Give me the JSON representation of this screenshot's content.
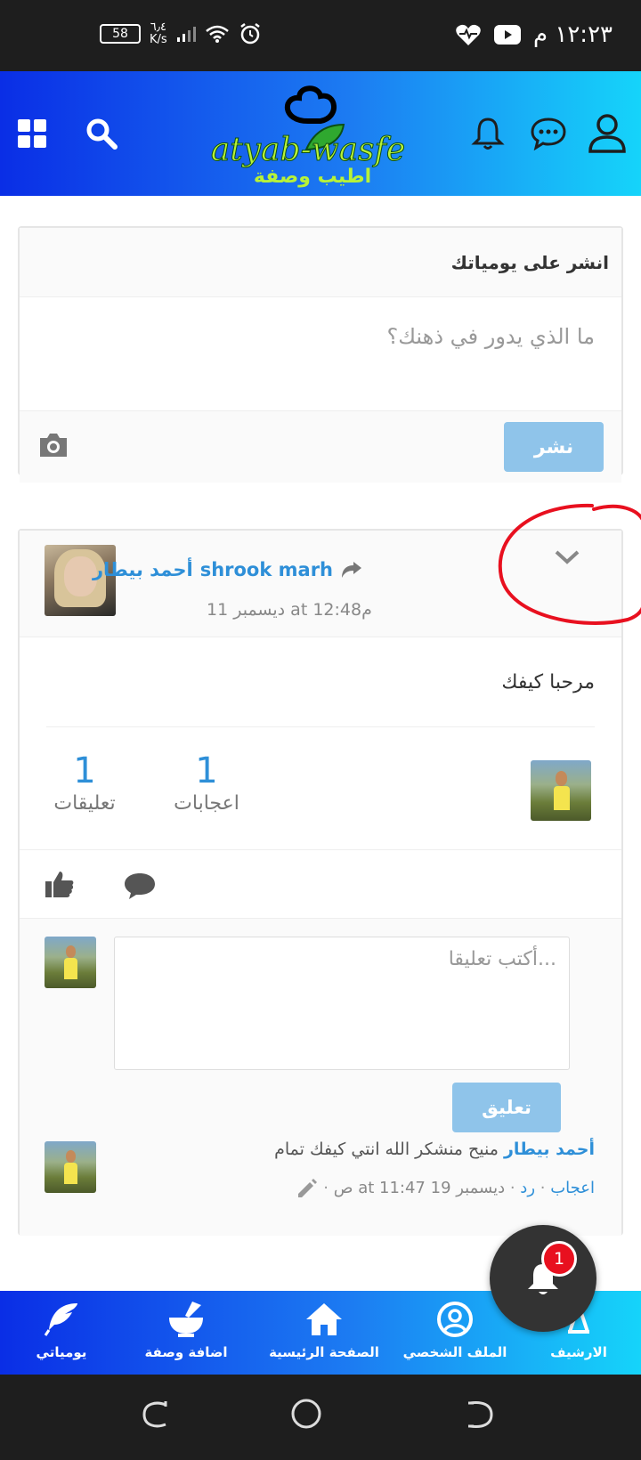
{
  "status_bar": {
    "battery": "58",
    "net_speed_value": "٦٫٤",
    "net_speed_unit": "K/s",
    "time": "١٢:٢٣ م"
  },
  "header": {
    "logo_text": "atyab-wasfe",
    "logo_subtitle": "اطيب وصفة"
  },
  "composer": {
    "title": "انشر على يومياتك",
    "placeholder": "ما الذي يدور في ذهنك؟",
    "publish_label": "نشر"
  },
  "post": {
    "author": "shrook marh",
    "shared_with": "أحمد بيطار",
    "timestamp": "ديسمبر 11 at 12:48م",
    "text": "مرحبا كيفك",
    "likes_count": "1",
    "likes_label": "اعجابات",
    "comments_count": "1",
    "comments_label": "تعليقات"
  },
  "comment_form": {
    "placeholder": "أكتب تعليقا...",
    "submit_label": "تعليق"
  },
  "comment": {
    "author": "أحمد بيطار",
    "text": "منيح منشكر الله انتي كيفك تمام",
    "like_label": "اعجاب",
    "reply_label": "رد",
    "timestamp": "ديسمبر 19 at 11:47 ص"
  },
  "notifications_badge": "1",
  "bottom_nav": {
    "archive": "الارشيف",
    "profile": "الملف الشخصي",
    "home": "الصفحة الرئيسية",
    "add_recipe": "اضافة وصفة",
    "diaries": "يومياتي"
  },
  "colors": {
    "accent": "#2e8fd8",
    "button_light": "#8fc4ea",
    "badge_red": "#e8101f"
  }
}
